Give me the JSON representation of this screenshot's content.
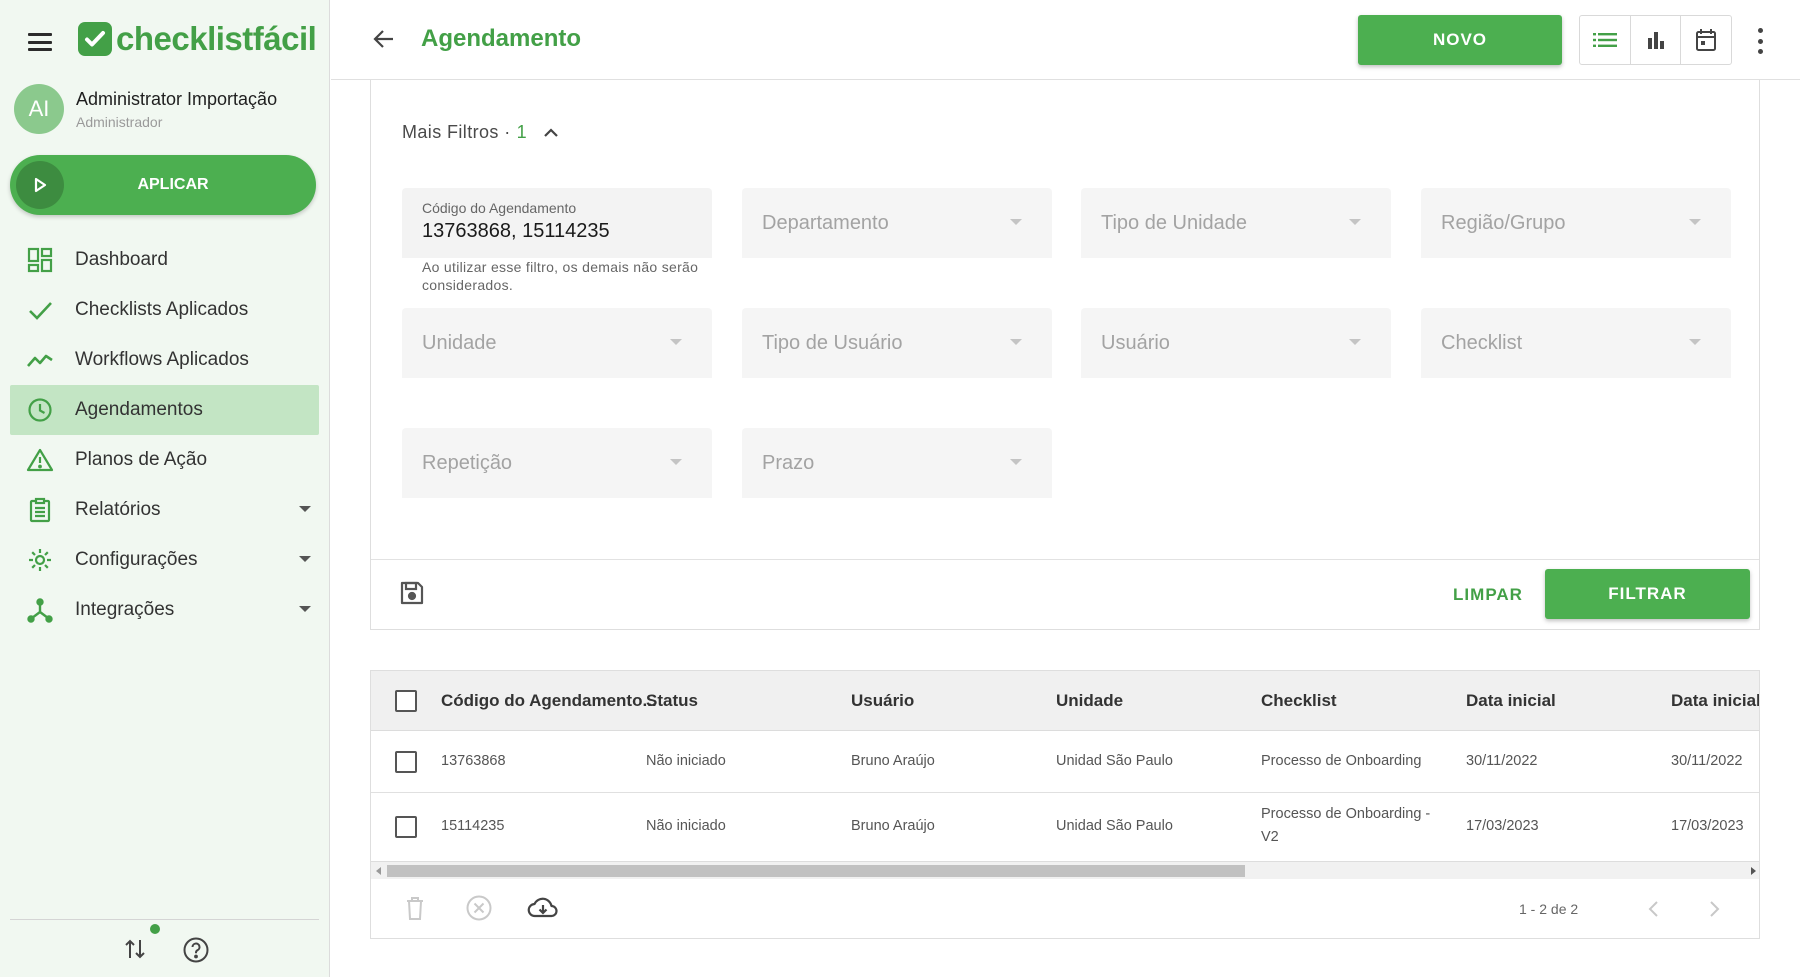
{
  "sidebar": {
    "brand": "checklistfácil",
    "user": {
      "initials": "AI",
      "name": "Administrator Importação",
      "role": "Administrador"
    },
    "apply_label": "APLICAR",
    "items": [
      {
        "label": "Dashboard",
        "icon": "dashboard-icon"
      },
      {
        "label": "Checklists Aplicados",
        "icon": "check-icon"
      },
      {
        "label": "Workflows Aplicados",
        "icon": "trending-icon"
      },
      {
        "label": "Agendamentos",
        "icon": "clock-icon",
        "active": true
      },
      {
        "label": "Planos de Ação",
        "icon": "warning-icon"
      },
      {
        "label": "Relatórios",
        "icon": "clipboard-icon",
        "has_submenu": true
      },
      {
        "label": "Configurações",
        "icon": "gear-icon",
        "has_submenu": true
      },
      {
        "label": "Integrações",
        "icon": "integration-icon",
        "has_submenu": true
      }
    ]
  },
  "header": {
    "title": "Agendamento",
    "new_label": "NOVO"
  },
  "filters": {
    "more_label": "Mais Filtros ·",
    "more_count": "1",
    "code": {
      "label": "Código do Agendamento",
      "value": "13763868, 15114235",
      "helper": "Ao utilizar esse filtro, os demais não serão considerados."
    },
    "selects": {
      "departamento": "Departamento",
      "tipo_unidade": "Tipo de Unidade",
      "regiao": "Região/Grupo",
      "unidade": "Unidade",
      "tipo_usuario": "Tipo de Usuário",
      "usuario": "Usuário",
      "checklist": "Checklist",
      "repeticao": "Repetição",
      "prazo": "Prazo"
    },
    "clear_label": "LIMPAR",
    "filter_label": "FILTRAR"
  },
  "table": {
    "columns": [
      "Código do Agendamento...",
      "Status",
      "Usuário",
      "Unidade",
      "Checklist",
      "Data inicial",
      "Data inicial"
    ],
    "rows": [
      [
        "13763868",
        "Não iniciado",
        "Bruno Araújo",
        "Unidad São Paulo",
        "Processo de Onboarding",
        "30/11/2022",
        "30/11/2022"
      ],
      [
        "15114235",
        "Não iniciado",
        "Bruno Araújo",
        "Unidad São Paulo",
        "Processo de Onboarding - V2",
        "17/03/2023",
        "17/03/2023"
      ]
    ],
    "pagination": "1 - 2 de 2"
  },
  "colors": {
    "brand": "#43a047",
    "active_nav": "#c3e5c4",
    "sidebar_bg": "#f1f8f1"
  }
}
